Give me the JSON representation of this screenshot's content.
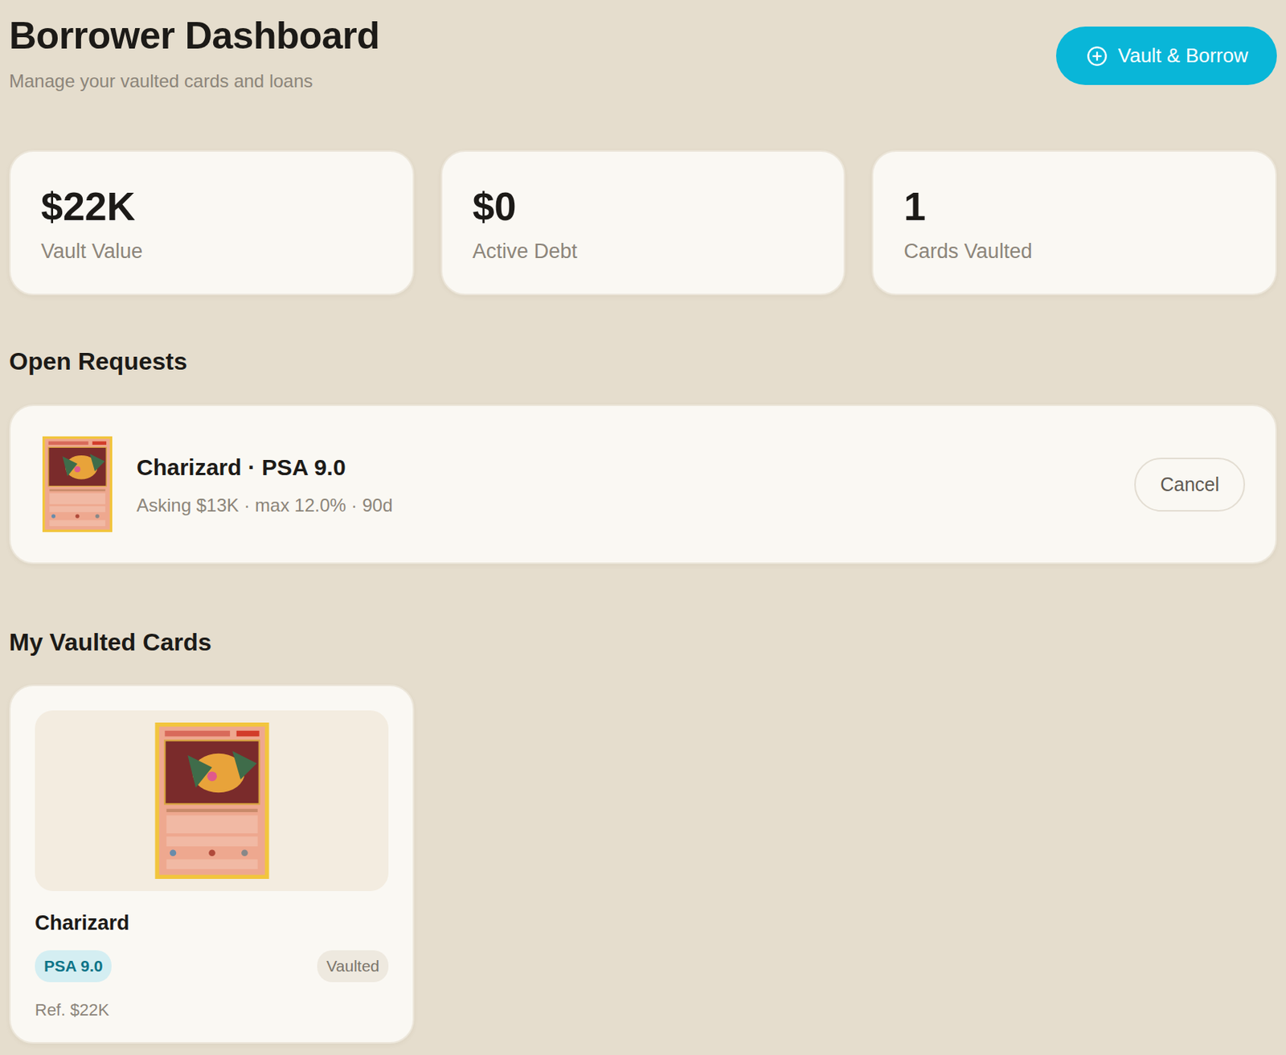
{
  "header": {
    "title": "Borrower Dashboard",
    "subtitle": "Manage your vaulted cards and loans",
    "action": "Vault & Borrow"
  },
  "stats": [
    {
      "value": "$22K",
      "label": "Vault Value"
    },
    {
      "value": "$0",
      "label": "Active Debt"
    },
    {
      "value": "1",
      "label": "Cards Vaulted"
    }
  ],
  "open_requests": {
    "heading": "Open Requests",
    "items": [
      {
        "title": "Charizard · PSA 9.0",
        "detail": "Asking $13K · max 12.0% · 90d",
        "action": "Cancel"
      }
    ]
  },
  "vaulted": {
    "heading": "My Vaulted Cards",
    "items": [
      {
        "name": "Charizard",
        "grade": "PSA 9.0",
        "status": "Vaulted",
        "ref": "Ref. $22K"
      }
    ]
  }
}
